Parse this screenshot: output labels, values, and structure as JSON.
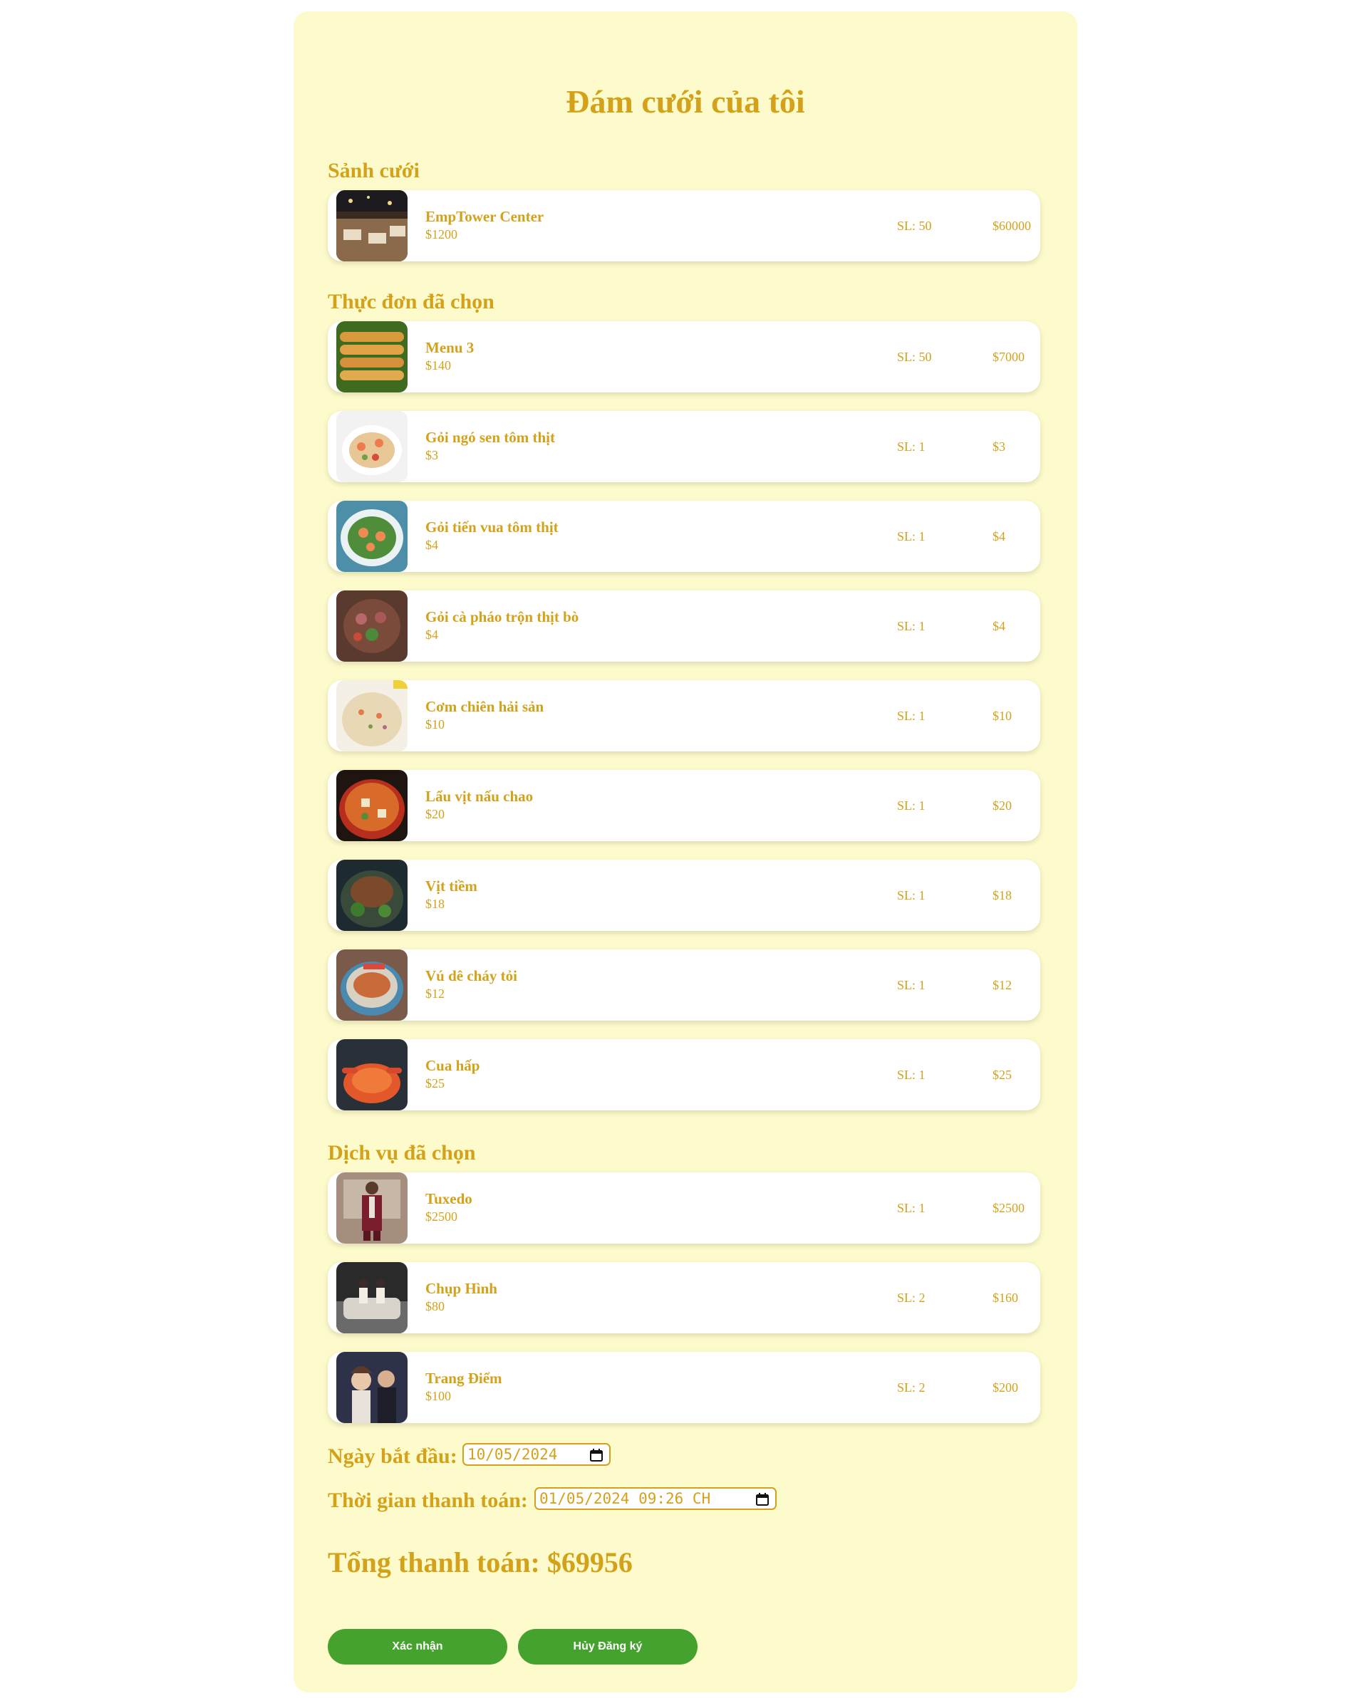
{
  "page": {
    "title": "Đám cưới của tôi"
  },
  "hall_section": {
    "title": "Sảnh cưới",
    "items": [
      {
        "name": "EmpTower Center",
        "price": "$1200",
        "qty": "SL: 50",
        "total": "$60000",
        "image": "wedding-hall-photo"
      }
    ]
  },
  "menu_section": {
    "title": "Thực đơn đã chọn",
    "items": [
      {
        "name": "Menu 3",
        "price": "$140",
        "qty": "SL: 50",
        "total": "$7000",
        "image": "spring-rolls-photo"
      },
      {
        "name": "Gỏi ngó sen tôm thịt",
        "price": "$3",
        "qty": "SL: 1",
        "total": "$3",
        "image": "lotus-salad-photo"
      },
      {
        "name": "Gỏi tiến vua tôm thịt",
        "price": "$4",
        "qty": "SL: 1",
        "total": "$4",
        "image": "shrimp-salad-photo"
      },
      {
        "name": "Gỏi cà pháo trộn thịt bò",
        "price": "$4",
        "qty": "SL: 1",
        "total": "$4",
        "image": "beef-salad-photo"
      },
      {
        "name": "Cơm chiên hải sản",
        "price": "$10",
        "qty": "SL: 1",
        "total": "$10",
        "image": "fried-rice-photo"
      },
      {
        "name": "Lẩu vịt nấu chao",
        "price": "$20",
        "qty": "SL: 1",
        "total": "$20",
        "image": "duck-hotpot-photo"
      },
      {
        "name": "Vịt tiềm",
        "price": "$18",
        "qty": "SL: 1",
        "total": "$18",
        "image": "braised-duck-photo"
      },
      {
        "name": "Vú dê cháy tỏi",
        "price": "$12",
        "qty": "SL: 1",
        "total": "$12",
        "image": "garlic-dish-photo"
      },
      {
        "name": "Cua hấp",
        "price": "$25",
        "qty": "SL: 1",
        "total": "$25",
        "image": "steamed-crab-photo"
      }
    ]
  },
  "service_section": {
    "title": "Dịch vụ đã chọn",
    "items": [
      {
        "name": "Tuxedo",
        "price": "$2500",
        "qty": "SL: 1",
        "total": "$2500",
        "image": "tuxedo-photo"
      },
      {
        "name": "Chụp Hình",
        "price": "$80",
        "qty": "SL: 2",
        "total": "$160",
        "image": "wedding-photoshoot-photo"
      },
      {
        "name": "Trang Điểm",
        "price": "$100",
        "qty": "SL: 2",
        "total": "$200",
        "image": "makeup-photo"
      }
    ]
  },
  "form": {
    "start_date_label": "Ngày bắt đầu:",
    "start_date_value": "10/05/2024",
    "payment_time_label": "Thời gian thanh toán:",
    "payment_time_value": "01/05/2024 09:26 CH",
    "calendar_icon": "calendar-icon"
  },
  "summary": {
    "total_text": "Tổng thanh toán: $69956"
  },
  "actions": {
    "confirm_label": "Xác nhận",
    "cancel_label": "Hủy Đăng ký"
  },
  "colors": {
    "panel_bg": "#fdfbcb",
    "accent_gold": "#d4a21a",
    "button_green": "#46a22e",
    "card_bg": "#ffffff"
  }
}
